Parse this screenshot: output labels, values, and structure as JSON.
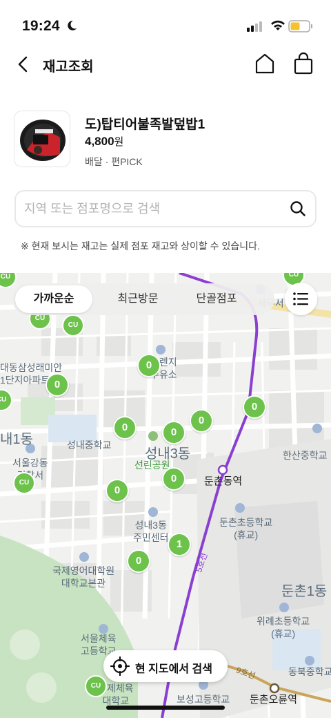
{
  "status_bar": {
    "time": "19:24"
  },
  "header": {
    "title": "재고조회"
  },
  "product": {
    "name": "도)탑티어불족발덮밥1",
    "price": "4,800",
    "price_unit": "원",
    "meta": "배달 · 편PICK"
  },
  "search": {
    "placeholder": "지역 또는 점포명으로 검색"
  },
  "notice": "※ 현재 보시는 재고는 실제 점포 재고와 상이할 수 있습니다.",
  "tabs": [
    {
      "label": "가까운순",
      "active": true
    },
    {
      "label": "최근방문",
      "active": false
    },
    {
      "label": "단골점포",
      "active": false
    }
  ],
  "map": {
    "store_pins": [
      "0",
      "0",
      "0",
      "0",
      "0",
      "0",
      "0",
      "0",
      "0",
      "1",
      "0"
    ],
    "cu_badge": "CU",
    "labels": {
      "seongnae1": "내1동",
      "daedong": "대동삼성래미안\n1단지아파트",
      "seoul_gangdong": "서울강동\n경찰서",
      "seongnae_middle": "성내중학교",
      "seongnae3": "성내3동",
      "seonrin_park": "선린공원",
      "seongnae3_center": "성내3동\n주민센터",
      "intl_language_univ": "국제영어대학원\n대학교본관",
      "seoul_pe_high": "서울체육\n고등학교",
      "korea_pe_univ": "국제체육\n대학교",
      "boseong_high": "보성고등학교",
      "dunchon_station": "둔촌동역",
      "dunchon_elem": "둔촌초등학교\n(휴교)",
      "dunchon1": "둔촌1동",
      "wirye_elem": "위례초등학교\n(휴교)",
      "dongbuk_middle": "동북중학교",
      "dunchon_oryun": "둔촌오륜역",
      "hansan_middle": "한산중학교",
      "tax_office": "세무서",
      "oil_station": "오렌지\n주유소",
      "line5": "5호선",
      "line9": "9호선"
    }
  },
  "search_here": {
    "label": "현 지도에서 검색"
  },
  "colors": {
    "pin_green": "#6cc24a",
    "line5_purple": "#8a3fd1",
    "line9_gold": "#c9a45a"
  }
}
